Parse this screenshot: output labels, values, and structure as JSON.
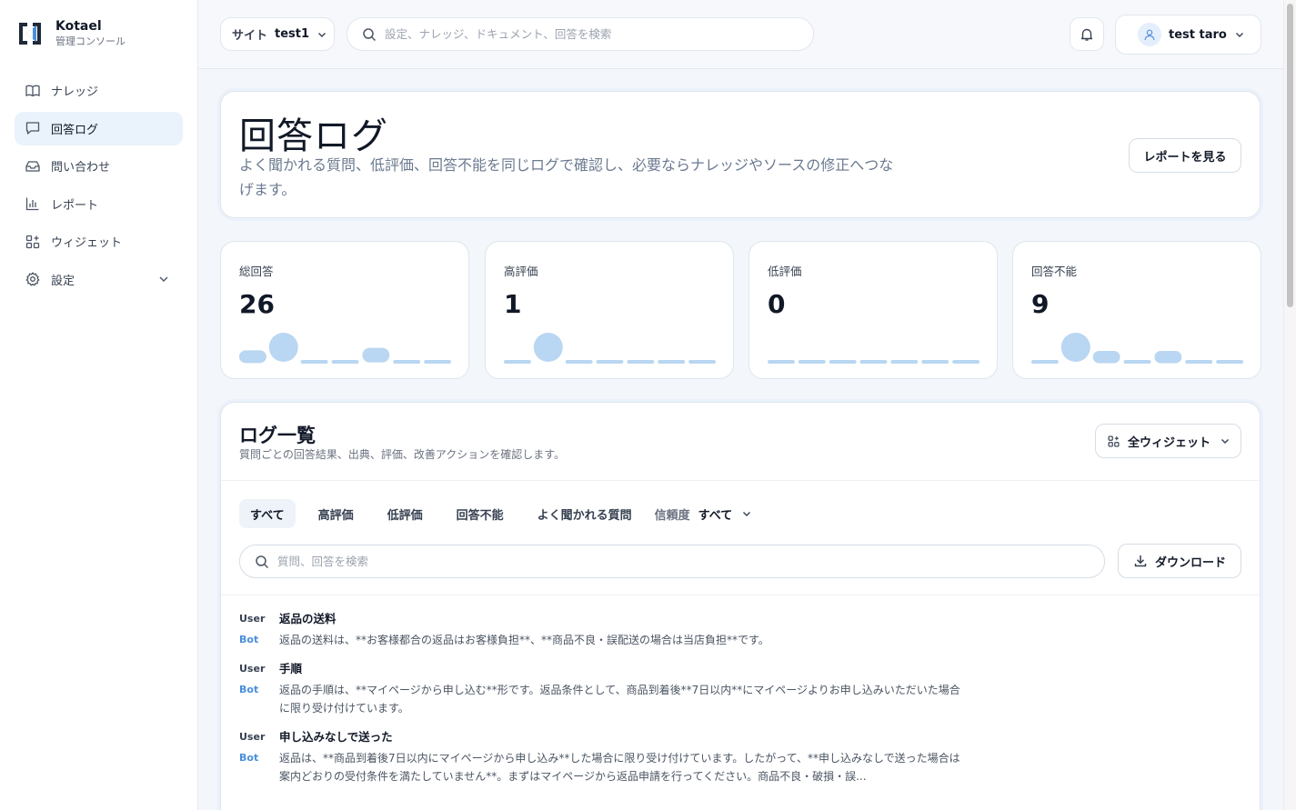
{
  "brand": {
    "name": "Kotael",
    "subtitle": "管理コンソール"
  },
  "sidebar": {
    "items": [
      {
        "label": "ナレッジ",
        "icon": "book-icon"
      },
      {
        "label": "回答ログ",
        "icon": "chat-icon",
        "active": true
      },
      {
        "label": "問い合わせ",
        "icon": "inbox-icon"
      },
      {
        "label": "レポート",
        "icon": "bar-chart-icon"
      },
      {
        "label": "ウィジェット",
        "icon": "widgets-icon"
      },
      {
        "label": "設定",
        "icon": "gear-icon"
      }
    ]
  },
  "topbar": {
    "site_label": "サイト",
    "site_value": "test1",
    "search_placeholder": "設定、ナレッジ、ドキュメント、回答を検索",
    "user_name": "test taro"
  },
  "hero": {
    "title": "回答ログ",
    "description": "よく聞かれる質問、低評価、回答不能を同じログで確認し、必要ならナレッジやソースの修正へつなげます。",
    "report_button": "レポートを見る"
  },
  "stats": [
    {
      "label": "総回答",
      "value": "26",
      "spark": [
        1,
        3,
        0,
        0,
        2,
        0,
        0
      ]
    },
    {
      "label": "高評価",
      "value": "1",
      "spark": [
        0,
        1,
        0,
        0,
        0,
        0,
        0
      ]
    },
    {
      "label": "低評価",
      "value": "0",
      "spark": [
        0,
        0,
        0,
        0,
        0,
        0,
        0
      ]
    },
    {
      "label": "回答不能",
      "value": "9",
      "spark": [
        0,
        4,
        1,
        0,
        1,
        0,
        0
      ]
    }
  ],
  "logs": {
    "title": "ログ一覧",
    "subtitle": "質問ごとの回答結果、出典、評価、改善アクションを確認します。",
    "widget_filter": "全ウィジェット",
    "tabs": [
      "すべて",
      "高評価",
      "低評価",
      "回答不能",
      "よく聞かれる質問"
    ],
    "confidence_label": "信頼度",
    "confidence_value": "すべて",
    "search_placeholder": "質問、回答を検索",
    "download_label": "ダウンロード",
    "user_role": "User",
    "bot_role": "Bot",
    "entries": [
      {
        "question": "返品の送料",
        "answer": "返品の送料は、**お客様都合の返品はお客様負担**、**商品不良・誤配送の場合は当店負担**です。"
      },
      {
        "question": "手順",
        "answer": "返品の手順は、**マイページから申し込む**形です。返品条件として、商品到着後**7日以内**にマイページよりお申し込みいただいた場合に限り受け付けています。"
      },
      {
        "question": "申し込みなしで送った",
        "answer": "返品は、**商品到着後7日以内にマイページから申し込み**した場合に限り受け付けています。したがって、**申し込みなしで送った場合は案内どおりの受付条件を満たしていません**。まずはマイページから返品申請を行ってください。商品不良・破損・誤..."
      }
    ]
  },
  "colors": {
    "accent": "#4a8fdc",
    "spark": "#b9d6f2",
    "active_nav": "#eaf2fb"
  }
}
